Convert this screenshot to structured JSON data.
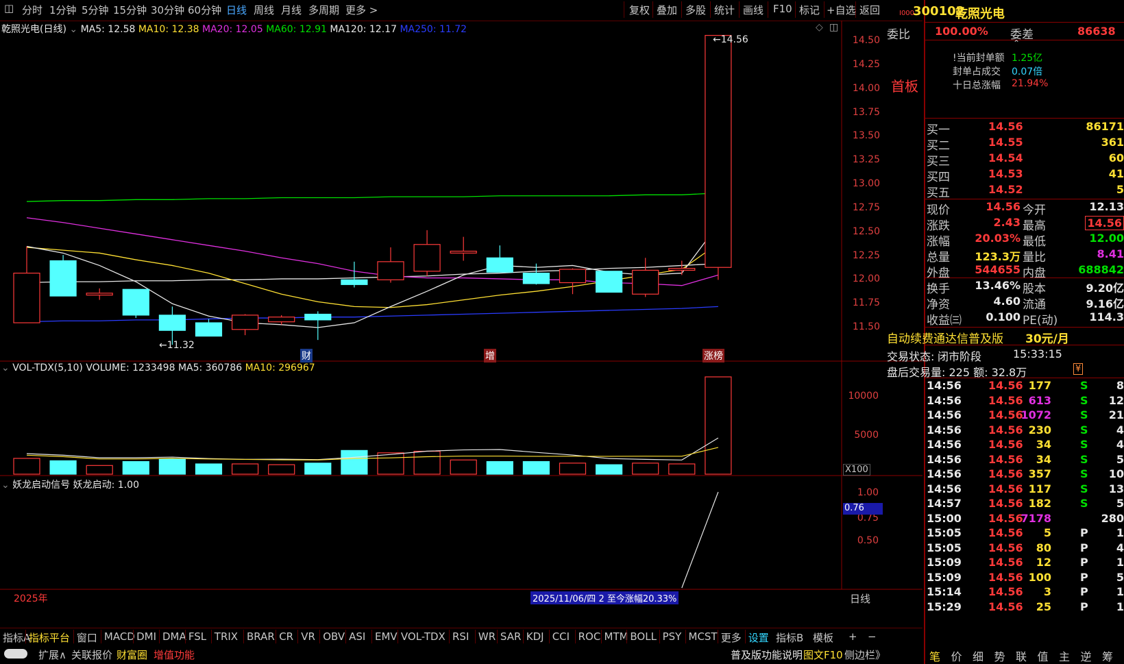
{
  "period_tabs": [
    "分时",
    "1分钟",
    "5分钟",
    "15分钟",
    "30分钟",
    "60分钟",
    "日线",
    "周线",
    "月线",
    "多周期",
    "更多 >"
  ],
  "active_period": "日线",
  "toolbar_buttons": [
    "复权",
    "叠加",
    "多股",
    "统计",
    "画线",
    "F10",
    "标记",
    "+自选",
    "返回"
  ],
  "main_legend": {
    "title": "乾照光电(日线)",
    "ma": [
      {
        "label": "MA5: 12.58",
        "color": "#e8e8e8"
      },
      {
        "label": "MA10: 12.38",
        "color": "#ffe033"
      },
      {
        "label": "MA20: 12.05",
        "color": "#e030e0"
      },
      {
        "label": "MA60: 12.91",
        "color": "#00e000"
      },
      {
        "label": "MA120: 12.17",
        "color": "#e8e8e8"
      },
      {
        "label": "MA250: 11.72",
        "color": "#2a3cff"
      }
    ]
  },
  "price_axis": [
    "14.50",
    "14.25",
    "14.00",
    "13.75",
    "13.50",
    "13.25",
    "13.00",
    "12.75",
    "12.50",
    "12.25",
    "12.00",
    "11.75",
    "11.50"
  ],
  "max_label": "14.56",
  "min_label": "11.32",
  "event_markers": [
    "财",
    "增",
    "涨榜"
  ],
  "vol_legend": {
    "name": "VOL-TDX(5,10)",
    "volume": "VOLUME: 1233498",
    "ma5": "MA5: 360786",
    "ma10": "MA10: 296967"
  },
  "vol_axis": [
    "10000",
    "5000",
    "X100"
  ],
  "signal_legend": {
    "name": "妖龙启动信号",
    "value": "妖龙启动: 1.00"
  },
  "signal_axis": [
    "1.00",
    "0.75",
    "0.50"
  ],
  "signal_current": "0.76",
  "year_label": "2025年",
  "range_info": "2025/11/06/四 2 至今涨幅20.33%",
  "period_label": "日线",
  "chart_data": {
    "type": "candlestick",
    "candles": [
      {
        "o": 11.55,
        "h": 12.35,
        "l": 11.55,
        "c": 12.07,
        "up": true
      },
      {
        "o": 12.2,
        "h": 12.26,
        "l": 11.83,
        "c": 11.83,
        "up": false
      },
      {
        "o": 11.86,
        "h": 11.91,
        "l": 11.79,
        "c": 11.84,
        "up": true
      },
      {
        "o": 11.9,
        "h": 11.9,
        "l": 11.6,
        "c": 11.63,
        "up": false
      },
      {
        "o": 11.63,
        "h": 11.72,
        "l": 11.32,
        "c": 11.47,
        "up": false
      },
      {
        "o": 11.55,
        "h": 11.59,
        "l": 11.41,
        "c": 11.41,
        "up": false
      },
      {
        "o": 11.48,
        "h": 11.64,
        "l": 11.42,
        "c": 11.63,
        "up": true
      },
      {
        "o": 11.56,
        "h": 11.63,
        "l": 11.53,
        "c": 11.61,
        "up": true
      },
      {
        "o": 11.64,
        "h": 11.67,
        "l": 11.37,
        "c": 11.58,
        "up": false
      },
      {
        "o": 12.0,
        "h": 12.19,
        "l": 11.92,
        "c": 11.95,
        "up": false
      },
      {
        "o": 12.0,
        "h": 12.34,
        "l": 11.97,
        "c": 12.19,
        "up": true
      },
      {
        "o": 12.09,
        "h": 12.52,
        "l": 12.04,
        "c": 12.37,
        "up": true
      },
      {
        "o": 12.3,
        "h": 12.45,
        "l": 12.2,
        "c": 12.28,
        "up": true
      },
      {
        "o": 12.23,
        "h": 12.36,
        "l": 12.08,
        "c": 12.08,
        "up": false
      },
      {
        "o": 12.07,
        "h": 12.17,
        "l": 11.95,
        "c": 11.96,
        "up": false
      },
      {
        "o": 11.97,
        "h": 12.12,
        "l": 11.85,
        "c": 12.11,
        "up": true
      },
      {
        "o": 12.09,
        "h": 12.09,
        "l": 11.87,
        "c": 11.87,
        "up": false
      },
      {
        "o": 11.85,
        "h": 12.23,
        "l": 11.82,
        "c": 12.1,
        "up": true
      },
      {
        "o": 12.1,
        "h": 12.2,
        "l": 12.05,
        "c": 12.12,
        "up": true
      },
      {
        "o": 12.13,
        "h": 14.56,
        "l": 12.0,
        "c": 14.56,
        "up": true
      }
    ],
    "volumes": [
      2.0,
      1.7,
      1.1,
      1.6,
      1.9,
      1.3,
      1.3,
      1.2,
      1.4,
      3.0,
      2.7,
      2.9,
      1.8,
      1.6,
      1.6,
      1.4,
      1.2,
      1.4,
      1.3,
      12.3
    ],
    "vol_up": [
      true,
      false,
      true,
      false,
      false,
      false,
      true,
      true,
      false,
      false,
      true,
      true,
      true,
      false,
      false,
      true,
      false,
      true,
      true,
      true
    ],
    "ma5": [
      12.35,
      12.28,
      12.15,
      11.98,
      11.75,
      11.62,
      11.55,
      11.53,
      11.5,
      11.55,
      11.72,
      11.88,
      12.05,
      12.15,
      12.13,
      12.15,
      12.08,
      12.05,
      12.07,
      12.58
    ],
    "ma10": [
      12.34,
      12.31,
      12.28,
      12.21,
      12.15,
      12.07,
      11.96,
      11.85,
      11.77,
      11.72,
      11.71,
      11.74,
      11.79,
      11.84,
      11.88,
      11.93,
      11.99,
      12.05,
      12.11,
      12.38
    ],
    "ma20": [
      12.65,
      12.6,
      12.54,
      12.48,
      12.42,
      12.36,
      12.3,
      12.23,
      12.17,
      12.09,
      12.04,
      12.02,
      12.02,
      12.01,
      12.0,
      12.0,
      11.97,
      11.96,
      11.94,
      12.05
    ],
    "ma60": [
      12.82,
      12.83,
      12.83,
      12.84,
      12.84,
      12.85,
      12.85,
      12.86,
      12.86,
      12.86,
      12.87,
      12.87,
      12.87,
      12.88,
      12.88,
      12.88,
      12.88,
      12.89,
      12.89,
      12.91
    ],
    "ma120": [
      11.97,
      11.98,
      11.98,
      11.99,
      11.99,
      12.0,
      12.0,
      12.01,
      12.01,
      12.02,
      12.03,
      12.04,
      12.06,
      12.07,
      12.09,
      12.1,
      12.12,
      12.13,
      12.15,
      12.17
    ],
    "ma250": [
      11.56,
      11.57,
      11.57,
      11.58,
      11.58,
      11.59,
      11.6,
      11.6,
      11.61,
      11.61,
      11.62,
      11.63,
      11.64,
      11.65,
      11.66,
      11.67,
      11.68,
      11.69,
      11.7,
      11.72
    ],
    "signal": [
      null,
      null,
      null,
      null,
      null,
      null,
      null,
      null,
      null,
      null,
      null,
      null,
      null,
      null,
      null,
      null,
      null,
      null,
      0.0,
      1.0
    ],
    "ylim": [
      11.5,
      14.5
    ]
  },
  "stock": {
    "code": "300102",
    "name": "乾照光电",
    "weibi_label": "委比",
    "weibi": "100.00%",
    "weicha_label": "委差",
    "weicha": "86638",
    "board": "首板",
    "seal_amount_label": "当前封单额",
    "seal_amount": "1.25亿",
    "seal_ratio_label": "封单占成交",
    "seal_ratio": "0.07倍",
    "ten_day_label": "十日总涨幅",
    "ten_day": "21.94%"
  },
  "bids": [
    {
      "label": "买一",
      "price": "14.56",
      "vol": "86171"
    },
    {
      "label": "买二",
      "price": "14.55",
      "vol": "361"
    },
    {
      "label": "买三",
      "price": "14.54",
      "vol": "60"
    },
    {
      "label": "买四",
      "price": "14.53",
      "vol": "41"
    },
    {
      "label": "买五",
      "price": "14.52",
      "vol": "5"
    }
  ],
  "quote": [
    {
      "l1": "现价",
      "v1": "14.56",
      "l2": "今开",
      "v2": "12.13",
      "c1": "red",
      "c2": "wht"
    },
    {
      "l1": "涨跌",
      "v1": "2.43",
      "l2": "最高",
      "v2": "14.56",
      "c1": "red",
      "c2": "red"
    },
    {
      "l1": "涨幅",
      "v1": "20.03%",
      "l2": "最低",
      "v2": "12.00",
      "c1": "red",
      "c2": "grn"
    },
    {
      "l1": "总量",
      "v1": "123.3万",
      "l2": "量比",
      "v2": "8.41",
      "c1": "yel",
      "c2": "mag"
    },
    {
      "l1": "外盘",
      "v1": "544655",
      "l2": "内盘",
      "v2": "688842",
      "c1": "red",
      "c2": "grn"
    }
  ],
  "fundamentals": [
    {
      "l1": "换手",
      "v1": "13.46%",
      "l2": "股本",
      "v2": "9.20亿"
    },
    {
      "l1": "净资",
      "v1": "4.60",
      "l2": "流通",
      "v2": "9.16亿"
    },
    {
      "l1": "收益㈢",
      "v1": "0.100",
      "l2": "PE(动)",
      "v2": "114.3"
    }
  ],
  "promo": {
    "text": "自动续费通达信普及版",
    "price": "30元/月"
  },
  "trade_status": {
    "label": "交易状态:",
    "value": "闭市阶段",
    "time": "15:33:15"
  },
  "after_hours": "盘后交易量: 225  额: 32.8万",
  "ticks": [
    {
      "t": "14:56",
      "p": "14.56",
      "v": "177",
      "d": "S",
      "n": "8",
      "vc": "yel"
    },
    {
      "t": "14:56",
      "p": "14.56",
      "v": "613",
      "d": "S",
      "n": "12",
      "vc": "mag"
    },
    {
      "t": "14:56",
      "p": "14.56",
      "v": "1072",
      "d": "S",
      "n": "21",
      "vc": "mag"
    },
    {
      "t": "14:56",
      "p": "14.56",
      "v": "230",
      "d": "S",
      "n": "4",
      "vc": "yel"
    },
    {
      "t": "14:56",
      "p": "14.56",
      "v": "34",
      "d": "S",
      "n": "4",
      "vc": "yel"
    },
    {
      "t": "14:56",
      "p": "14.56",
      "v": "34",
      "d": "S",
      "n": "5",
      "vc": "yel"
    },
    {
      "t": "14:56",
      "p": "14.56",
      "v": "357",
      "d": "S",
      "n": "10",
      "vc": "yel"
    },
    {
      "t": "14:56",
      "p": "14.56",
      "v": "117",
      "d": "S",
      "n": "13",
      "vc": "yel"
    },
    {
      "t": "14:57",
      "p": "14.56",
      "v": "182",
      "d": "S",
      "n": "5",
      "vc": "yel"
    },
    {
      "t": "15:00",
      "p": "14.56",
      "v": "7178",
      "d": "",
      "n": "280",
      "vc": "mag"
    },
    {
      "t": "15:05",
      "p": "14.56",
      "v": "5",
      "d": "P",
      "n": "1",
      "vc": "yel"
    },
    {
      "t": "15:05",
      "p": "14.56",
      "v": "80",
      "d": "P",
      "n": "4",
      "vc": "yel"
    },
    {
      "t": "15:09",
      "p": "14.56",
      "v": "12",
      "d": "P",
      "n": "1",
      "vc": "yel"
    },
    {
      "t": "15:09",
      "p": "14.56",
      "v": "100",
      "d": "P",
      "n": "5",
      "vc": "yel"
    },
    {
      "t": "15:14",
      "p": "14.56",
      "v": "3",
      "d": "P",
      "n": "1",
      "vc": "yel"
    },
    {
      "t": "15:29",
      "p": "14.56",
      "v": "25",
      "d": "P",
      "n": "1",
      "vc": "yel"
    }
  ],
  "indicator_tabs": [
    "指标A",
    "指标平台",
    "窗口",
    "MACD",
    "DMI",
    "DMA",
    "FSL",
    "TRIX",
    "BRAR",
    "CR",
    "VR",
    "OBV",
    "ASI",
    "EMV",
    "VOL-TDX",
    "RSI",
    "WR",
    "SAR",
    "KDJ",
    "CCI",
    "ROC",
    "MTM",
    "BOLL",
    "PSY",
    "MCST",
    "更多",
    "设置"
  ],
  "indicator_right": [
    "指标B",
    "模板",
    "+",
    "−"
  ],
  "bottom_items": [
    "扩展∧",
    "关联报价",
    "财富圈",
    "增值功能"
  ],
  "bottom_right": "普及版功能说明",
  "bottom_right2": "图文F10",
  "bottom_right3": "侧边栏》",
  "right_tabs": [
    "笔",
    "价",
    "细",
    "势",
    "联",
    "值",
    "主",
    "逆",
    "筹"
  ],
  "colors": {
    "up": "#ff3a3a",
    "down": "#54ffff",
    "axis": "#8a0000"
  }
}
